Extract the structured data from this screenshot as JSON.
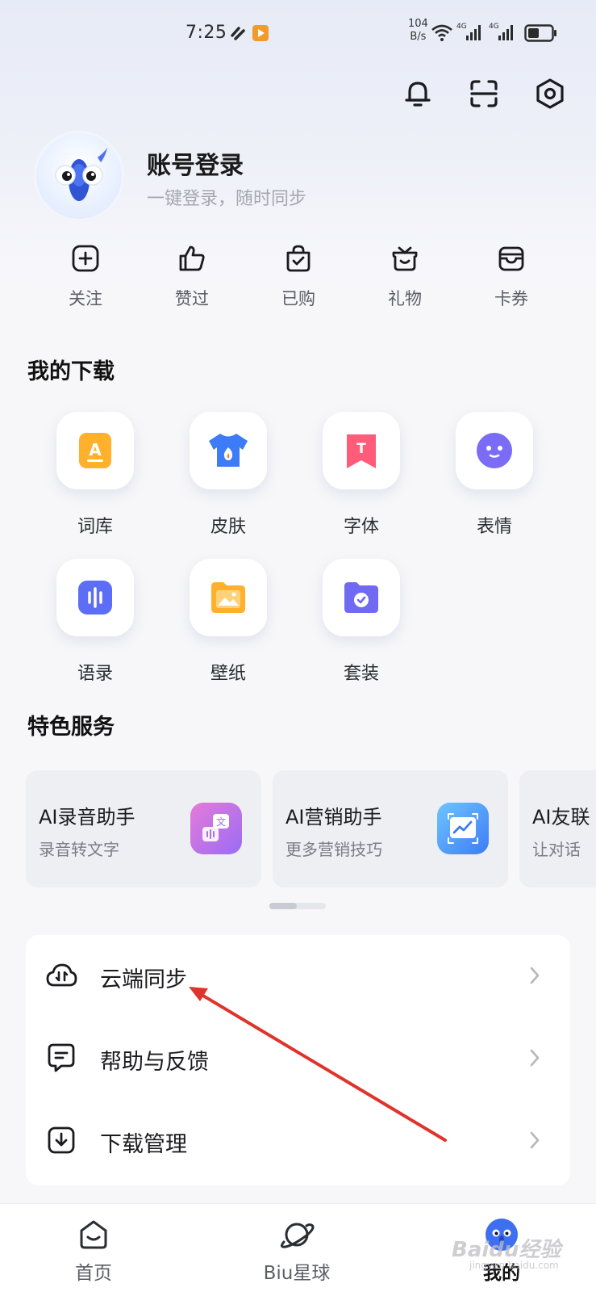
{
  "status_bar": {
    "time": "7:25",
    "net_speed_value": "104",
    "net_speed_unit": "B/s",
    "signal_1_label": "4G",
    "signal_2_label": "4G"
  },
  "header": {
    "icons": [
      "bell-icon",
      "scan-icon",
      "settings-icon"
    ]
  },
  "profile": {
    "title": "账号登录",
    "subtitle": "一键登录，随时同步"
  },
  "quick_actions": [
    {
      "label": "关注",
      "icon": "plus-square-icon"
    },
    {
      "label": "赞过",
      "icon": "thumbs-up-icon"
    },
    {
      "label": "已购",
      "icon": "shopping-bag-icon"
    },
    {
      "label": "礼物",
      "icon": "gift-icon"
    },
    {
      "label": "卡券",
      "icon": "wallet-icon"
    }
  ],
  "downloads": {
    "title": "我的下载",
    "items": [
      {
        "label": "词库",
        "icon": "lexicon-icon",
        "color": "#ffb12e"
      },
      {
        "label": "皮肤",
        "icon": "skin-shirt-icon",
        "color": "#3d7cf6"
      },
      {
        "label": "字体",
        "icon": "font-icon",
        "color": "#ff5c7a"
      },
      {
        "label": "表情",
        "icon": "emoji-icon",
        "color": "#7b6cf6"
      },
      {
        "label": "语录",
        "icon": "quotes-icon",
        "color": "#5b6ef5"
      },
      {
        "label": "壁纸",
        "icon": "wallpaper-icon",
        "color": "#ffb12e"
      },
      {
        "label": "套装",
        "icon": "bundle-folder-icon",
        "color": "#7069f2"
      }
    ]
  },
  "services": {
    "title": "特色服务",
    "cards": [
      {
        "title": "AI录音助手",
        "subtitle": "录音转文字",
        "icon": "translate-voice-icon"
      },
      {
        "title": "AI营销助手",
        "subtitle": "更多营销技巧",
        "icon": "marketing-chart-icon"
      },
      {
        "title": "AI友联",
        "subtitle": "让对话",
        "icon": "chat-icon"
      }
    ]
  },
  "menu": [
    {
      "label": "云端同步",
      "icon": "cloud-sync-icon"
    },
    {
      "label": "帮助与反馈",
      "icon": "feedback-icon"
    },
    {
      "label": "下载管理",
      "icon": "download-manage-icon"
    }
  ],
  "tab_bar": {
    "items": [
      {
        "label": "首页",
        "icon": "home-icon",
        "active": false
      },
      {
        "label": "Biu星球",
        "icon": "planet-icon",
        "active": false
      },
      {
        "label": "我的",
        "icon": "profile-mascot-icon",
        "active": true
      }
    ]
  },
  "watermark": {
    "text": "Baidu经验",
    "sub": "jingyan.baidu.com"
  },
  "colors": {
    "annotation_arrow": "#e0332b",
    "accent_blue": "#3d7cf6"
  }
}
